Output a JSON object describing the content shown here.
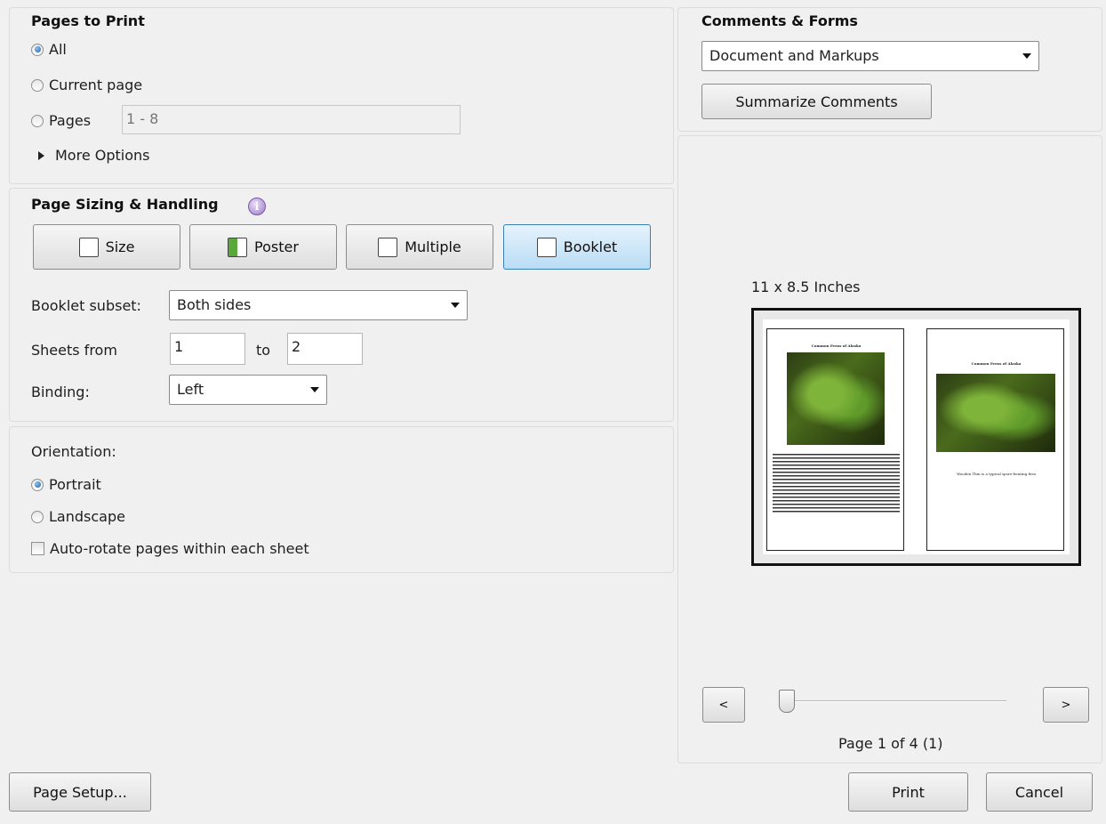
{
  "pages_to_print": {
    "title": "Pages to Print",
    "all": "All",
    "current_page": "Current page",
    "pages": "Pages",
    "pages_range": "1 - 8",
    "more_options": "More Options",
    "selected": "All"
  },
  "sizing": {
    "title": "Page Sizing & Handling",
    "buttons": [
      "Size",
      "Poster",
      "Multiple",
      "Booklet"
    ],
    "active": "Booklet",
    "booklet_subset_label": "Booklet subset:",
    "booklet_subset_value": "Both sides",
    "sheets_from_label": "Sheets from",
    "sheets_from": "1",
    "to_label": "to",
    "sheets_to": "2",
    "binding_label": "Binding:",
    "binding_value": "Left"
  },
  "orientation": {
    "title": "Orientation:",
    "portrait": "Portrait",
    "landscape": "Landscape",
    "auto_rotate": "Auto-rotate pages within each sheet",
    "selected": "Portrait",
    "auto_rotate_checked": false
  },
  "comments_forms": {
    "title": "Comments & Forms",
    "value": "Document and Markups",
    "summarize": "Summarize Comments"
  },
  "preview": {
    "size_label": "11 x 8.5 Inches",
    "left_page_title": "Common Ferns of Alaska",
    "right_page_title": "Common Ferns of Alaska",
    "right_page_caption": "Wooden Thin is a typical spore-bearing fern",
    "prev": "<",
    "next": ">",
    "page_status": "Page 1 of 4 (1)"
  },
  "footer": {
    "page_setup": "Page Setup...",
    "print": "Print",
    "cancel": "Cancel"
  }
}
